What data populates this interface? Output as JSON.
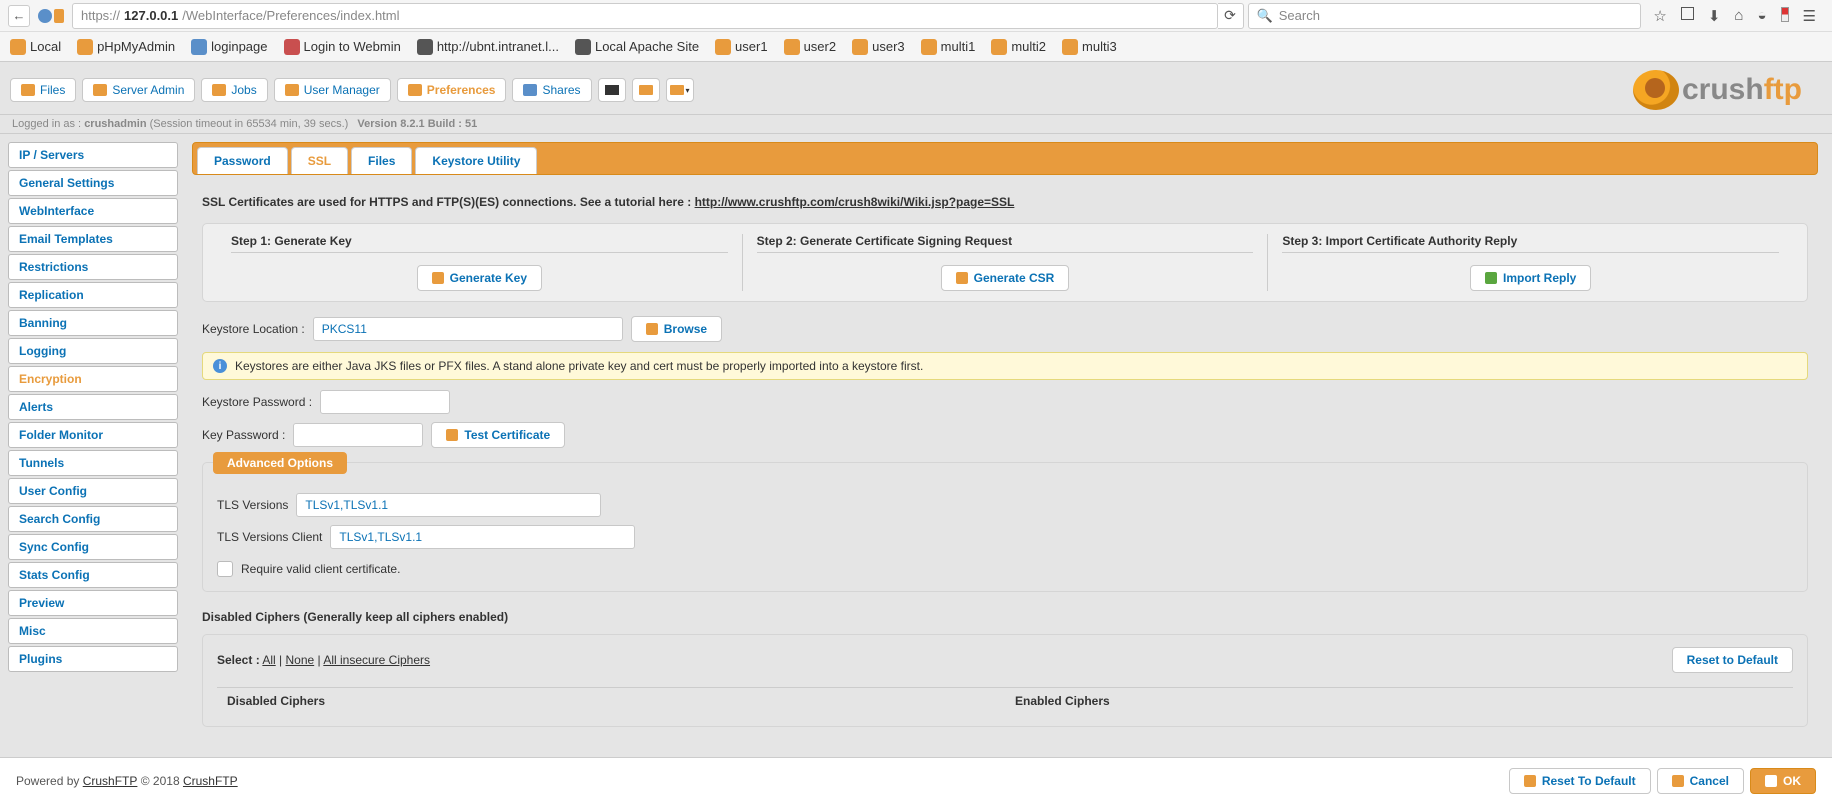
{
  "browser": {
    "url_proto": "https://",
    "url_host": "127.0.0.1",
    "url_path": "/WebInterface/Preferences/index.html",
    "search_placeholder": "Search"
  },
  "bookmarks": [
    "Local",
    "pHpMyAdmin",
    "loginpage",
    "Login to Webmin",
    "http://ubnt.intranet.l...",
    "Local Apache Site",
    "user1",
    "user2",
    "user3",
    "multi1",
    "multi2",
    "multi3"
  ],
  "topTabs": {
    "files": "Files",
    "serverAdmin": "Server Admin",
    "jobs": "Jobs",
    "userManager": "User Manager",
    "preferences": "Preferences",
    "shares": "Shares"
  },
  "logo": {
    "part1": "crush",
    "part2": "ftp"
  },
  "status": {
    "loggedPrefix": "Logged in as :",
    "user": "crushadmin",
    "session": "(Session timeout in 65534 min, 39 secs.)",
    "version": "Version 8.2.1 Build : 51"
  },
  "sidebar": [
    "IP / Servers",
    "General Settings",
    "WebInterface",
    "Email Templates",
    "Restrictions",
    "Replication",
    "Banning",
    "Logging",
    "Encryption",
    "Alerts",
    "Folder Monitor",
    "Tunnels",
    "User Config",
    "Search Config",
    "Sync Config",
    "Stats Config",
    "Preview",
    "Misc",
    "Plugins"
  ],
  "tabs": [
    "Password",
    "SSL",
    "Files",
    "Keystore Utility"
  ],
  "ssl": {
    "intro_text": "SSL Certificates are used for HTTPS and FTP(S)(ES) connections. See a tutorial here :",
    "intro_link": "http://www.crushftp.com/crush8wiki/Wiki.jsp?page=SSL",
    "step1_title": "Step 1: Generate Key",
    "step1_btn": "Generate Key",
    "step2_title": "Step 2: Generate Certificate Signing Request",
    "step2_btn": "Generate CSR",
    "step3_title": "Step 3: Import Certificate Authority Reply",
    "step3_btn": "Import Reply",
    "keystore_loc_label": "Keystore Location :",
    "keystore_loc_value": "PKCS11",
    "browse_btn": "Browse",
    "info_text": "Keystores are either Java JKS files or PFX files. A stand alone private key and cert must be properly imported into a keystore first.",
    "keystore_pw_label": "Keystore Password :",
    "key_pw_label": "Key Password :",
    "test_cert_btn": "Test Certificate",
    "adv_header": "Advanced Options",
    "tls_label": "TLS Versions",
    "tls_value": "TLSv1,TLSv1.1",
    "tls_client_label": "TLS Versions Client",
    "tls_client_value": "TLSv1,TLSv1.1",
    "require_cert_label": "Require valid client certificate.",
    "disabled_ciphers_title": "Disabled Ciphers (Generally keep all ciphers enabled)",
    "select_label": "Select :",
    "sel_all": "All",
    "sel_none": "None",
    "sel_insecure": "All insecure Ciphers",
    "reset_default_btn": "Reset to Default",
    "col_disabled": "Disabled Ciphers",
    "col_enabled": "Enabled Ciphers"
  },
  "footer": {
    "powered": "Powered by",
    "brand": "CrushFTP",
    "copyright": "© 2018",
    "brand2": "CrushFTP",
    "reset": "Reset To Default",
    "cancel": "Cancel",
    "ok": "OK"
  }
}
